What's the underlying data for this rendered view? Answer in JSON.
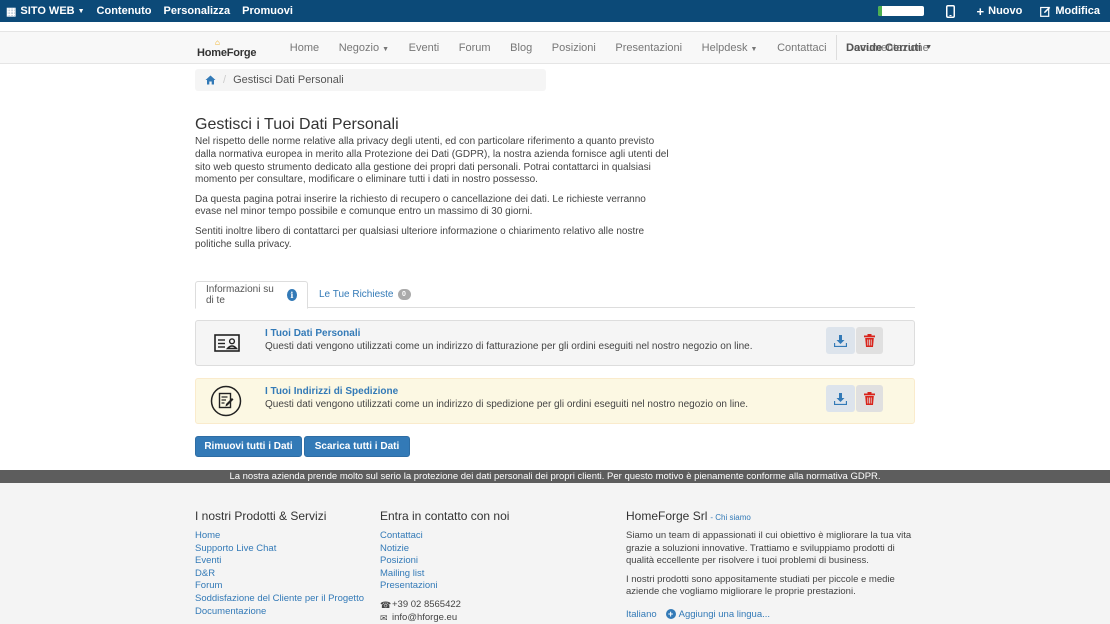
{
  "adminbar": {
    "site_label": "SITO WEB",
    "content_label": "Contenuto",
    "customize_label": "Personalizza",
    "promote_label": "Promuovi",
    "new_label": "Nuovo",
    "edit_label": "Modifica"
  },
  "navbar": {
    "brand": "HomeForge",
    "links": [
      "Home",
      "Negozio",
      "Eventi",
      "Forum",
      "Blog",
      "Posizioni",
      "Presentazioni",
      "Helpdesk",
      "Contattaci",
      "Documentazione"
    ],
    "user": "Davide Cerruti"
  },
  "breadcrumb": {
    "current": "Gestisci Dati Personali"
  },
  "main": {
    "title": "Gestisci i Tuoi Dati Personali",
    "paragraphs": [
      "Nel rispetto delle norme relative alla privacy degli utenti, ed con particolare riferimento a quanto previsto dalla normativa europea in merito alla Protezione dei Dati (GDPR), la nostra azienda fornisce agli utenti del sito web questo strumento dedicato alla gestione dei propri dati personali. Potrai contattarci in qualsiasi momento per consultare, modificare o eliminare tutti i dati in nostro possesso.",
      "Da questa pagina potrai inserire la richiesto di recupero o cancellazione dei dati. Le richieste verranno evase nel minor tempo possibile e comunque entro un massimo di 30 giorni.",
      "Sentiti inoltre libero di contattarci per qualsiasi ulteriore informazione o chiarimento relativo alle nostre politiche sulla privacy."
    ]
  },
  "tabs": {
    "info_label": "Informazioni su di te",
    "info_badge": "i",
    "requests_label": "Le Tue Richieste",
    "requests_count": "0"
  },
  "panels": [
    {
      "title": "I Tuoi Dati Personali",
      "description": "Questi dati vengono utilizzati come un indirizzo di fatturazione per gli ordini eseguiti nel nostro negozio on line.",
      "icon": "id-card-icon"
    },
    {
      "title": "I Tuoi Indirizzi di Spedizione",
      "description": "Questi dati vengono utilizzati come un indirizzo di spedizione per gli ordini eseguiti nel nostro negozio on line.",
      "icon": "edit-document-icon"
    }
  ],
  "actions": {
    "remove_all": "Rimuovi tutti i Dati",
    "download_all": "Scarica tutti i Dati"
  },
  "gdpr_notice": "La nostra azienda prende molto sul serio la protezione dei dati personali dei propri clienti. Per questo motivo è pienamente conforme alla normativa GDPR.",
  "footer": {
    "products_title": "I nostri Prodotti & Servizi",
    "products_links": [
      "Home",
      "Supporto Live Chat",
      "Eventi",
      "D&R",
      "Forum",
      "Soddisfazione del Cliente per il Progetto",
      "Documentazione"
    ],
    "contact_title": "Entra in contatto con noi",
    "contact_links": [
      "Contattaci",
      "Notizie",
      "Posizioni",
      "Mailing list",
      "Presentazioni"
    ],
    "phone": "+39 02 8565422",
    "email": "info@hforge.eu",
    "company_title": "HomeForge Srl",
    "company_link": "- Chi siamo",
    "company_paragraphs": [
      "Siamo un team di appassionati il cui obiettivo è migliorare la tua vita grazie a soluzioni innovative. Trattiamo e sviluppiamo prodotti di qualità eccellente per risolvere i tuoi problemi di business.",
      "I nostri prodotti sono appositamente studiati per piccole e medie aziende che vogliamo migliorare le proprie prestazioni."
    ],
    "language": "Italiano",
    "add_language": "Aggiungi una lingua..."
  },
  "colors": {
    "adminbar": "#0c4a78",
    "primary": "#337ab7",
    "danger": "#d9534f",
    "warning_panel": "#fcf8e3"
  }
}
